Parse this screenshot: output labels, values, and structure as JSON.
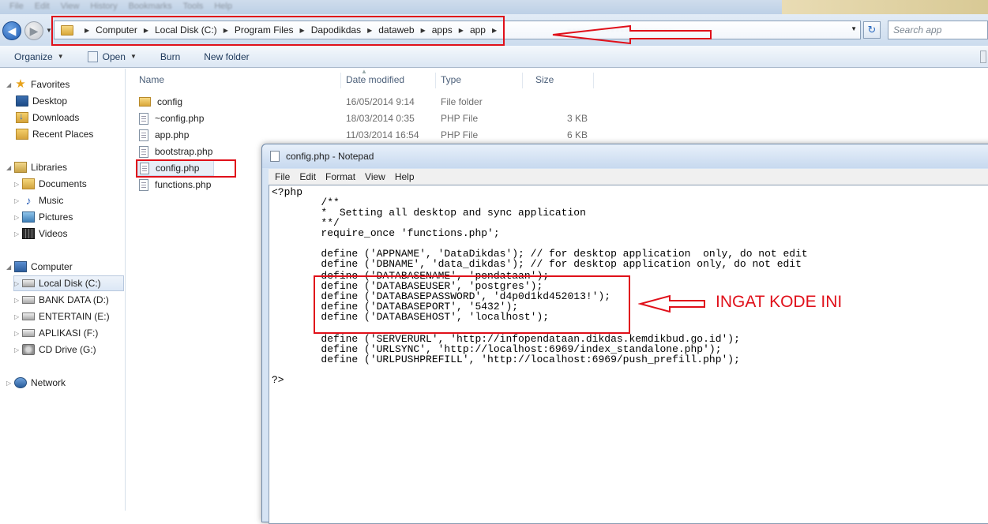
{
  "explorer": {
    "breadcrumb": [
      "Computer",
      "Local Disk (C:)",
      "Program Files",
      "Dapodikdas",
      "dataweb",
      "apps",
      "app"
    ],
    "search_placeholder": "Search app",
    "toolbar": {
      "organize": "Organize",
      "open": "Open",
      "burn": "Burn",
      "new_folder": "New folder"
    },
    "sidebar": {
      "favorites": "Favorites",
      "desktop": "Desktop",
      "downloads": "Downloads",
      "recent_places": "Recent Places",
      "libraries": "Libraries",
      "documents": "Documents",
      "music": "Music",
      "pictures": "Pictures",
      "videos": "Videos",
      "computer": "Computer",
      "local_disk": "Local Disk (C:)",
      "bank_data": "BANK DATA (D:)",
      "entertain": "ENTERTAIN (E:)",
      "aplikasi": "APLIKASI (F:)",
      "cd_drive": "CD Drive (G:)",
      "network": "Network"
    },
    "columns": {
      "name": "Name",
      "date": "Date modified",
      "type": "Type",
      "size": "Size"
    },
    "files": [
      {
        "name": "config",
        "date": "16/05/2014 9:14",
        "type": "File folder",
        "size": ""
      },
      {
        "name": "~config.php",
        "date": "18/03/2014 0:35",
        "type": "PHP File",
        "size": "3 KB"
      },
      {
        "name": "app.php",
        "date": "11/03/2014 16:54",
        "type": "PHP File",
        "size": "6 KB"
      },
      {
        "name": "bootstrap.php",
        "date": "",
        "type": "",
        "size": ""
      },
      {
        "name": "config.php",
        "date": "",
        "type": "",
        "size": ""
      },
      {
        "name": "functions.php",
        "date": "",
        "type": "",
        "size": ""
      }
    ]
  },
  "notepad": {
    "title": "config.php - Notepad",
    "menu": {
      "file": "File",
      "edit": "Edit",
      "format": "Format",
      "view": "View",
      "help": "Help"
    },
    "code_top": "<?php\n        /**\n        *  Setting all desktop and sync application\n        **/\n        require_once 'functions.php';\n\n        define ('APPNAME', 'DataDikdas'); // for desktop application  only, do not edit\n        define ('DBNAME', 'data_dikdas'); // for desktop application only, do not edit\n",
    "code_db": "        define ('DATABASENAME', 'pendataan');\n        define ('DATABASEUSER', 'postgres');\n        define ('DATABASEPASSWORD', 'd4p0d1kd452013!');\n        define ('DATABASEPORT', '5432');\n        define ('DATABASEHOST', 'localhost');\n",
    "code_bottom": "\n        define ('SERVERURL', 'http://infopendataan.dikdas.kemdikbud.go.id');\n        define ('URLSYNC', 'http://localhost:6969/index_standalone.php');\n        define ('URLPUSHPREFILL', 'http://localhost:6969/push_prefill.php');\n\n?>"
  },
  "annotation": {
    "label": "INGAT KODE INI",
    "color": "#e0101a"
  }
}
